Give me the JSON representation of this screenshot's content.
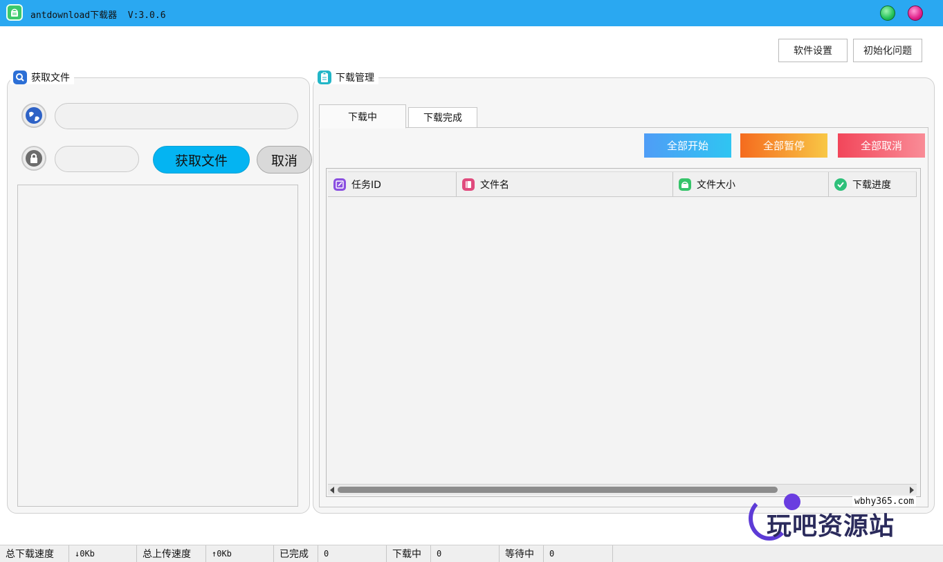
{
  "window": {
    "title": "antdownload下载器",
    "version": "V:3.0.6"
  },
  "toolbar": {
    "settings_label": "软件设置",
    "init_label": "初始化问题"
  },
  "fetch_panel": {
    "title": "获取文件",
    "url_value": "",
    "password_value": "",
    "fetch_label": "获取文件",
    "cancel_label": "取消"
  },
  "download_panel": {
    "title": "下载管理",
    "tabs": [
      {
        "label": "下载中",
        "active": true
      },
      {
        "label": "下载完成",
        "active": false
      }
    ],
    "actions": {
      "start_all": "全部开始",
      "pause_all": "全部暂停",
      "cancel_all": "全部取消"
    },
    "columns": [
      {
        "label": "任务ID",
        "icon": "edit-icon",
        "color": "#8a4fe0"
      },
      {
        "label": "文件名",
        "icon": "book-icon",
        "color": "#e04a7d"
      },
      {
        "label": "文件大小",
        "icon": "storage-icon",
        "color": "#36c46a"
      },
      {
        "label": "下载进度",
        "icon": "check-icon",
        "color": "#2ec07a"
      }
    ],
    "rows": []
  },
  "watermark": {
    "url": "wbhy365.com",
    "brand": "玩吧资源站"
  },
  "statusbar": {
    "download_speed_label": "总下载速度",
    "download_speed_value": "↓0Kb",
    "upload_speed_label": "总上传速度",
    "upload_speed_value": "↑0Kb",
    "completed_label": "已完成",
    "completed_value": "0",
    "downloading_label": "下载中",
    "downloading_value": "0",
    "waiting_label": "等待中",
    "waiting_value": "0"
  },
  "colors": {
    "titlebar": "#2aa8f1",
    "fetch_button": "#04b4f2"
  }
}
